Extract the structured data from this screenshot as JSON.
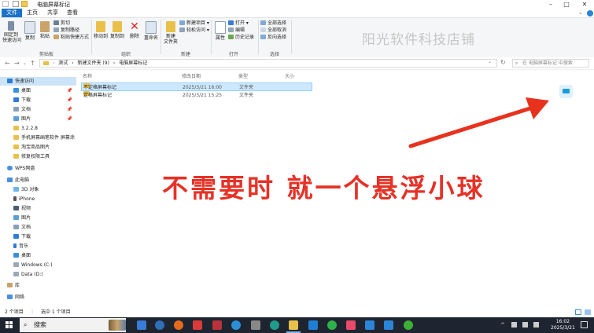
{
  "window": {
    "title": "电脑屏幕标记"
  },
  "tabs": [
    {
      "label": "文件",
      "active": true
    },
    {
      "label": "主页",
      "active": false
    },
    {
      "label": "共享",
      "active": false
    },
    {
      "label": "查看",
      "active": false
    }
  ],
  "ribbon": {
    "clipboard": {
      "pin": "固定到\n快速访问",
      "copy": "复制",
      "paste": "粘贴",
      "cut": "剪切",
      "copy_path": "复制路径",
      "paste_shortcut": "粘贴快捷方式",
      "group": "剪贴板"
    },
    "organize": {
      "move_to": "移动到",
      "copy_to": "复制到",
      "delete": "删除",
      "rename": "重命名",
      "group": "组织"
    },
    "new": {
      "new_folder": "新建\n文件夹",
      "new_item": "新建项目 ▾",
      "easy_access": "轻松访问 ▾",
      "group": "新建"
    },
    "open": {
      "properties": "属性",
      "open": "打开 ▾",
      "edit": "编辑",
      "history": "历史记录",
      "group": "打开"
    },
    "select": {
      "select_all": "全部选择",
      "select_none": "全部取消",
      "invert": "反向选择",
      "group": "选择"
    }
  },
  "watermark": "阳光软件科技店铺",
  "address": {
    "crumbs": [
      "测试",
      "›",
      "新建文件夹 (9)",
      "›",
      "电脑屏幕标记"
    ],
    "search_placeholder": "在 电脑屏幕标记 中搜索"
  },
  "nav": {
    "quick_access": "快速访问",
    "items": [
      {
        "label": "桌面",
        "pinned": true
      },
      {
        "label": "下载",
        "pinned": true
      },
      {
        "label": "文档",
        "pinned": true
      },
      {
        "label": "图片",
        "pinned": true
      },
      {
        "label": "3.2.2.8",
        "pinned": false
      },
      {
        "label": "手机屏幕画笔软件 屏幕涂",
        "pinned": false
      },
      {
        "label": "淘宝商品图片",
        "pinned": false
      },
      {
        "label": "修复权限工具",
        "pinned": false
      }
    ],
    "wps": "WPS网盘",
    "this_pc": "此电脑",
    "pc_items": [
      "3D 对象",
      "iPhone",
      "视频",
      "图片",
      "文档",
      "下载",
      "音乐",
      "桌面",
      "Windows (C:)",
      "Data (D:)"
    ],
    "library": "库",
    "network": "网络"
  },
  "list": {
    "headers": {
      "name": "名称",
      "modified": "修改日期",
      "type": "类型",
      "size": "大小"
    },
    "rows": [
      {
        "name": "不定格屏幕标记",
        "modified": "2025/3/21 16:00",
        "type": "文件夹",
        "selected": true
      },
      {
        "name": "定格屏幕标记",
        "modified": "2025/3/21 15:25",
        "type": "文件夹",
        "selected": false
      }
    ]
  },
  "overlay": {
    "caption": "不需要时 就一个悬浮小球"
  },
  "status": {
    "count": "2 个项目",
    "selection": "选中 1 个项目"
  },
  "taskbar": {
    "search_label": "搜索",
    "time": "16:02",
    "date": "2025/3/21"
  },
  "colors": {
    "accent": "#1a73c9",
    "caption": "#e53227",
    "arrow": "#e8321e",
    "taskbar": "#1f2530"
  }
}
